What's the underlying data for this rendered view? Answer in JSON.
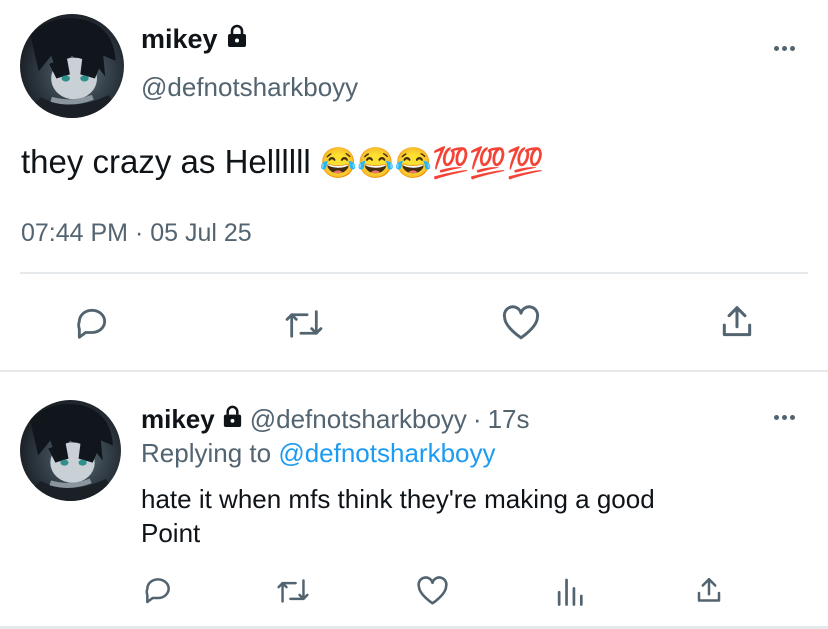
{
  "tweet": {
    "display_name": "mikey",
    "handle": "@defnotsharkboyy",
    "text": "they crazy as Hellllll",
    "emojis": "😂😂😂💯💯💯",
    "timestamp": "07:44 PM · 05 Jul 25"
  },
  "reply": {
    "display_name": "mikey",
    "handle": "@defnotsharkboyy",
    "separator": "·",
    "age": "17s",
    "replying_prefix": "Replying to",
    "replying_handle": "@defnotsharkboyy",
    "text_line1": "hate it when mfs think they're making a good",
    "text_line2": "Point"
  },
  "icons": {
    "lock": "lock-icon",
    "more": "more-icon",
    "reply": "reply-icon",
    "retweet": "retweet-icon",
    "like": "like-icon",
    "share": "share-icon",
    "views": "views-icon"
  },
  "colors": {
    "text": "#0f1419",
    "muted": "#536471",
    "link": "#1d9bf0",
    "divider": "#e6e9ec"
  }
}
